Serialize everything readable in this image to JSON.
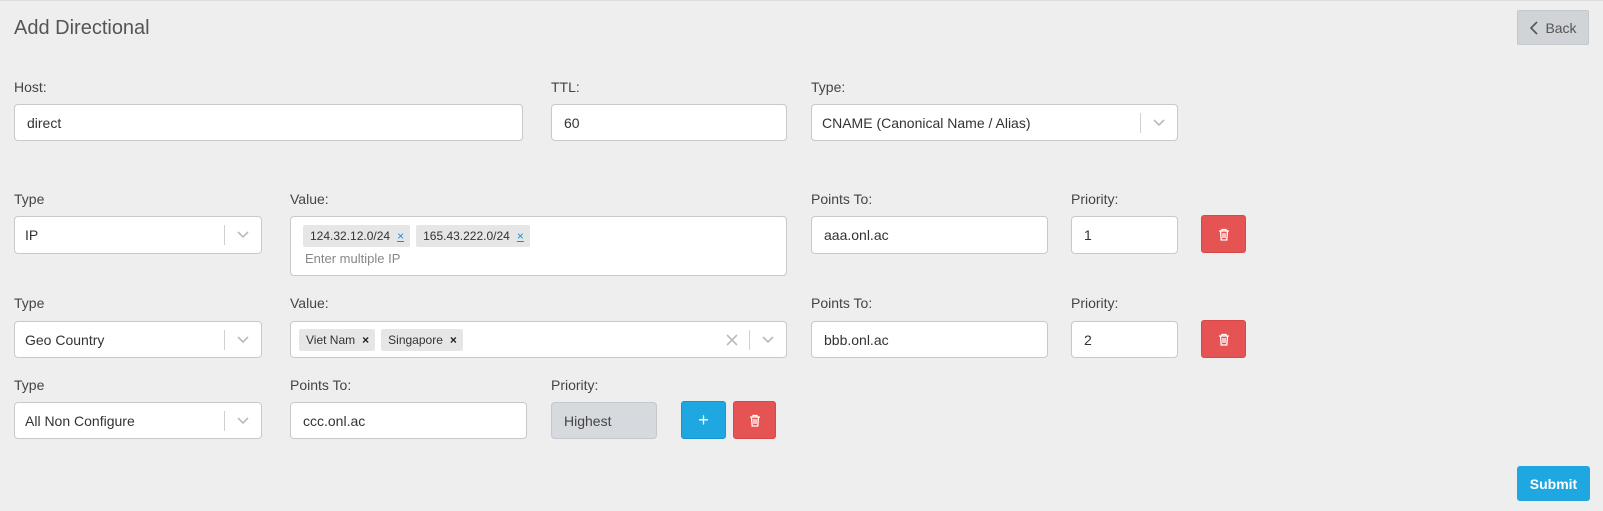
{
  "header": {
    "title": "Add Directional",
    "back_label": "Back"
  },
  "record": {
    "host_label": "Host:",
    "host_value": "direct",
    "ttl_label": "TTL:",
    "ttl_value": "60",
    "type_label": "Type:",
    "type_value": "CNAME (Canonical Name / Alias)"
  },
  "rules": [
    {
      "type_label": "Type",
      "type_value": "IP",
      "value_label": "Value:",
      "tags": [
        "124.32.12.0/24",
        "165.43.222.0/24"
      ],
      "tag_remove": "×",
      "placeholder": "Enter multiple IP",
      "points_label": "Points To:",
      "points_value": "aaa.onl.ac",
      "priority_label": "Priority:",
      "priority_value": "1"
    },
    {
      "type_label": "Type",
      "type_value": "Geo Country",
      "value_label": "Value:",
      "tags": [
        "Viet Nam",
        "Singapore"
      ],
      "tag_remove": "×",
      "points_label": "Points To:",
      "points_value": "bbb.onl.ac",
      "priority_label": "Priority:",
      "priority_value": "2"
    },
    {
      "type_label": "Type",
      "type_value": "All Non Configure",
      "points_label": "Points To:",
      "points_value": "ccc.onl.ac",
      "priority_label": "Priority:",
      "priority_value": "Highest",
      "add_label": "+"
    }
  ],
  "submit_label": "Submit",
  "colors": {
    "primary": "#1ea7e1",
    "danger": "#e55353",
    "background": "#eeeeee"
  },
  "icons": [
    "chevron-left-icon",
    "chevron-down-icon",
    "trash-icon",
    "clear-icon",
    "plus-icon"
  ]
}
